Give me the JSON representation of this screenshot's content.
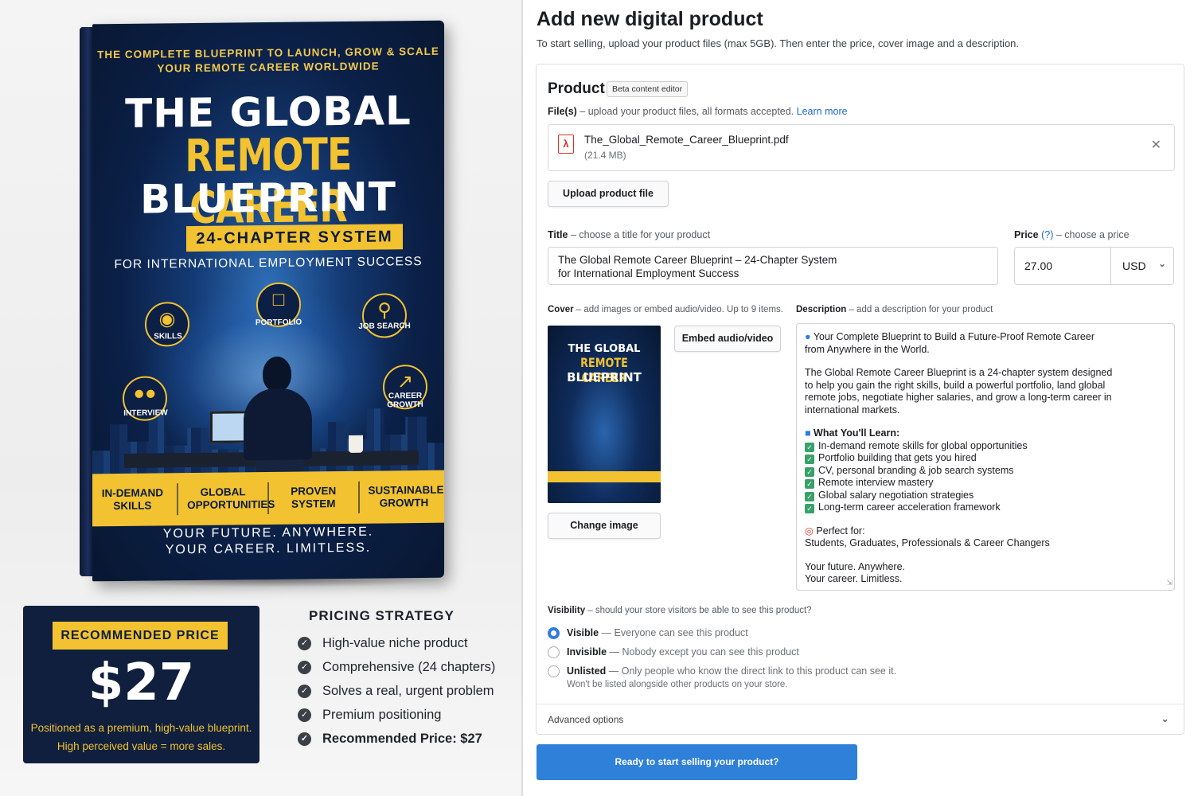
{
  "promo": {
    "book": {
      "tagline_line1": "THE COMPLETE BLUEPRINT TO LAUNCH, GROW & SCALE",
      "tagline_line2": "YOUR REMOTE CAREER WORLDWIDE",
      "title_line1": "THE GLOBAL",
      "title_line2": "REMOTE CAREER",
      "title_line3": "BLUEPRINT",
      "chapter_badge": "24-CHAPTER SYSTEM",
      "subtitle": "FOR INTERNATIONAL EMPLOYMENT SUCCESS",
      "icons": [
        {
          "label": "SKILLS",
          "icon": "brain-icon"
        },
        {
          "label": "PORTFOLIO",
          "icon": "folder-icon"
        },
        {
          "label": "JOB SEARCH",
          "icon": "search-icon"
        },
        {
          "label": "INTERVIEW",
          "icon": "people-icon"
        },
        {
          "label": "CAREER GROWTH",
          "icon": "growth-chart-icon"
        }
      ],
      "band": [
        "IN-DEMAND SKILLS",
        "GLOBAL OPPORTUNITIES",
        "PROVEN SYSTEM",
        "SUSTAINABLE GROWTH"
      ],
      "slogan_line1": "YOUR FUTURE. ANYWHERE.",
      "slogan_line2": "YOUR CAREER. LIMITLESS."
    },
    "recommended": {
      "label": "RECOMMENDED PRICE",
      "price": "$27",
      "note_line1": "Positioned as a premium, high-value blueprint.",
      "note_line2": "High perceived value = more sales."
    },
    "strategy": {
      "heading": "PRICING STRATEGY",
      "items": [
        "High-value niche product",
        "Comprehensive (24 chapters)",
        "Solves a real, urgent problem",
        "Premium positioning",
        "Recommended Price: $27"
      ]
    }
  },
  "form": {
    "title": "Add new digital product",
    "subtitle": "To start selling, upload your product files (max 5GB). Then enter the price, cover image and a description.",
    "product_heading": "Product",
    "beta_badge": "Beta content editor",
    "files_label": "File(s)",
    "files_hint": " – upload your product files, all formats accepted. ",
    "files_link": "Learn more",
    "file": {
      "name": "The_Global_Remote_Career_Blueprint.pdf",
      "size": "(21.4 MB)"
    },
    "upload_button": "Upload product file",
    "title_label": "Title",
    "title_hint": " – choose a title for your product",
    "title_value_line1": "The Global Remote Career Blueprint – 24-Chapter System",
    "title_value_line2": "for International Employment Success",
    "price_label": "Price",
    "price_help": "(?)",
    "price_hint": " – choose a price",
    "price_value": "27.00",
    "currency": "USD",
    "cover_label": "Cover",
    "cover_hint": " – add images or embed audio/video. Up to 9 items.",
    "embed_button": "Embed audio/video",
    "change_image_button": "Change image",
    "description_label": "Description",
    "description_hint": " – add a description for your product",
    "description": {
      "intro_line1": "Your Complete Blueprint to Build a Future-Proof Remote Career",
      "intro_line2": "from Anywhere in the World.",
      "para": [
        "The Global Remote Career Blueprint is a 24-chapter system designed",
        "to help you gain the right skills, build a powerful portfolio, land global",
        "remote jobs, negotiate higher salaries, and grow a long-term career in",
        "international markets."
      ],
      "learn_heading": "What You'll Learn:",
      "learn_items": [
        "In-demand remote skills for global opportunities",
        "Portfolio building that gets you hired",
        "CV, personal branding & job search systems",
        "Remote interview mastery",
        "Global salary negotiation strategies",
        "Long-term career acceleration framework"
      ],
      "perfect_heading": "Perfect for:",
      "perfect_text": "Students, Graduates, Professionals & Career Changers",
      "closing_line1": "Your future. Anywhere.",
      "closing_line2": "Your career. Limitless."
    },
    "visibility_label": "Visibility",
    "visibility_hint": " – should your store visitors be able to see this product?",
    "visibility_options": [
      {
        "name": "Visible",
        "desc": " — Everyone can see this product",
        "selected": true
      },
      {
        "name": "Invisible",
        "desc": " — Nobody except you can see this product",
        "selected": false
      },
      {
        "name": "Unlisted",
        "desc": " —  Only people who know the direct link to this product can see it.",
        "desc2": "Won't be listed alongside other products on your store.",
        "selected": false
      }
    ],
    "advanced_options": "Advanced options",
    "submit_button": "Ready to start selling your product?"
  }
}
